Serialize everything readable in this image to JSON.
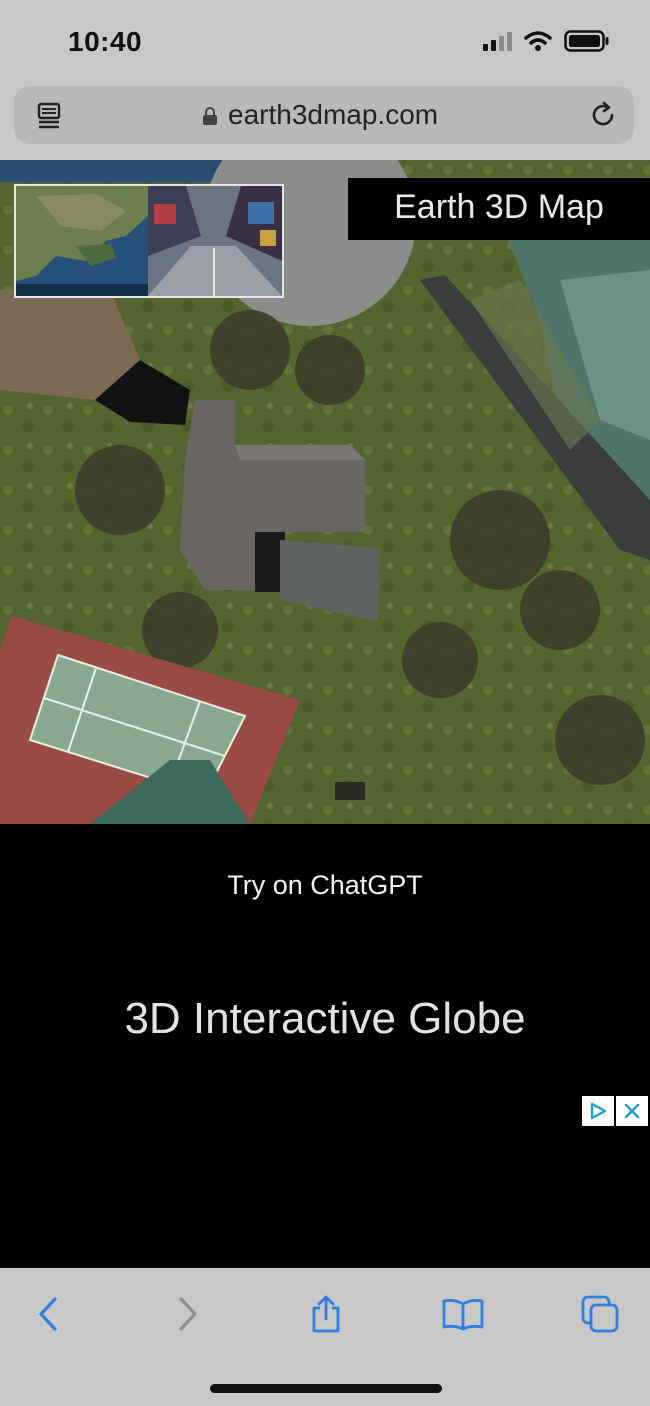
{
  "status_bar": {
    "time": "10:40",
    "signal_icon": "cellular-signal-icon",
    "wifi_icon": "wifi-icon",
    "battery_icon": "battery-icon"
  },
  "address_bar": {
    "url": "earth3dmap.com",
    "reader_icon": "reader-mode-icon",
    "lock_icon": "lock-icon",
    "reload_icon": "reload-icon"
  },
  "map": {
    "brand_title": "Earth 3D Map",
    "thumbnail_caption": "",
    "imagery": "satellite-aerial"
  },
  "promo": {
    "try_link": "Try on ChatGPT",
    "title": "3D Interactive Globe",
    "ad_icon": "adchoices-icon",
    "ad_close_icon": "close-icon",
    "ad_color": "#1a9fd0"
  },
  "toolbar": {
    "back_icon": "chevron-left-icon",
    "forward_icon": "chevron-right-icon",
    "share_icon": "share-icon",
    "bookmarks_icon": "book-icon",
    "tabs_icon": "tabs-icon",
    "accent": "#2f7fe0"
  }
}
